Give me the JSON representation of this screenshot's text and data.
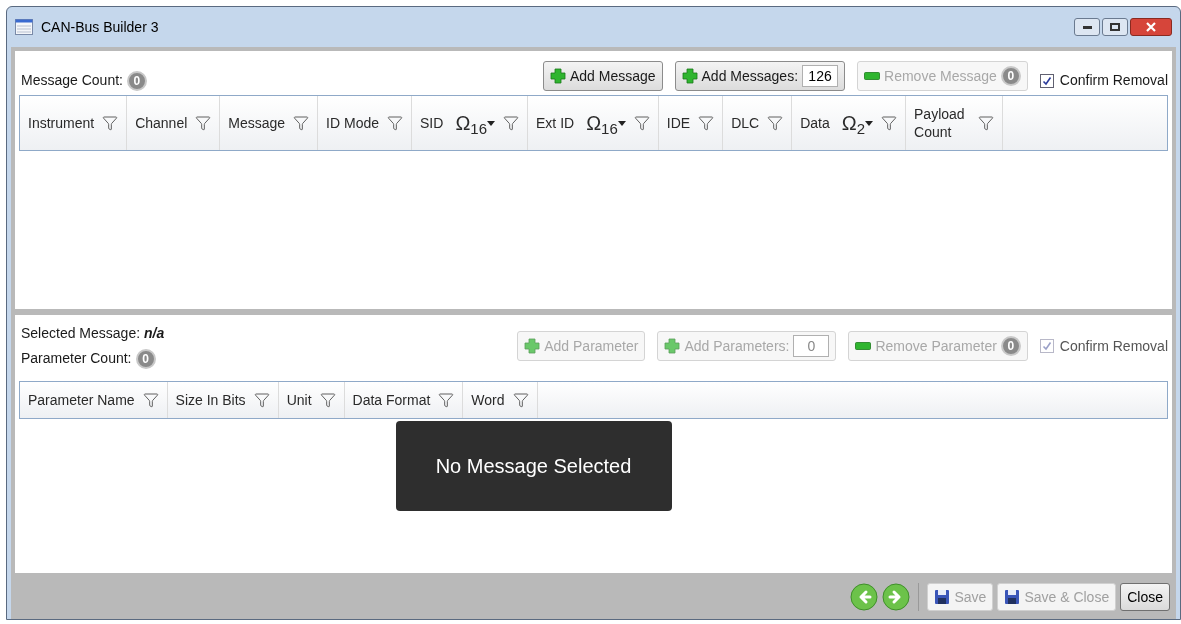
{
  "window": {
    "title": "CAN-Bus Builder 3"
  },
  "messages": {
    "count_label": "Message Count:",
    "count": "0",
    "buttons": [
      {
        "kind": "add",
        "label": "Add Message",
        "disabled": false
      },
      {
        "kind": "spin",
        "label": "Add Messages:",
        "value": "126",
        "disabled": false
      },
      {
        "kind": "remove",
        "label": "Remove Message",
        "count": "0",
        "disabled": true
      }
    ],
    "confirm": {
      "label": "Confirm Removal",
      "checked": true,
      "disabled": false
    },
    "columns": [
      {
        "label": "Instrument"
      },
      {
        "label": "Channel"
      },
      {
        "label": "Message"
      },
      {
        "label": "ID Mode"
      },
      {
        "label": "SID",
        "radix": "Ω$_{16}$"
      },
      {
        "label": "Ext ID",
        "radix": "Ω$_{16}$"
      },
      {
        "label": "IDE"
      },
      {
        "label": "DLC"
      },
      {
        "label": "Data",
        "radix": "Ω$_{2}$"
      },
      {
        "label": "Payload Count"
      }
    ]
  },
  "parameters": {
    "selected_label": "Selected Message:",
    "selected_value": "n/a",
    "count_label": "Parameter Count:",
    "count": "0",
    "buttons": [
      {
        "kind": "add",
        "label": "Add Parameter",
        "disabled": true
      },
      {
        "kind": "spin",
        "label": "Add Parameters:",
        "value": "0",
        "disabled": true
      },
      {
        "kind": "remove",
        "label": "Remove Parameter",
        "count": "0",
        "disabled": true
      }
    ],
    "confirm": {
      "label": "Confirm Removal",
      "checked": true,
      "disabled": true
    },
    "columns": [
      {
        "label": "Parameter Name"
      },
      {
        "label": "Size In Bits"
      },
      {
        "label": "Unit"
      },
      {
        "label": "Data Format"
      },
      {
        "label": "Word"
      }
    ],
    "empty_message": "No Message Selected"
  },
  "footer": {
    "nav": [
      {
        "kind": "back"
      },
      {
        "kind": "forward"
      }
    ],
    "buttons": [
      {
        "kind": "save",
        "label": "Save",
        "disabled": true
      },
      {
        "kind": "save",
        "label": "Save & Close",
        "disabled": true
      },
      {
        "kind": "plain",
        "label": "Close",
        "disabled": false
      }
    ]
  }
}
